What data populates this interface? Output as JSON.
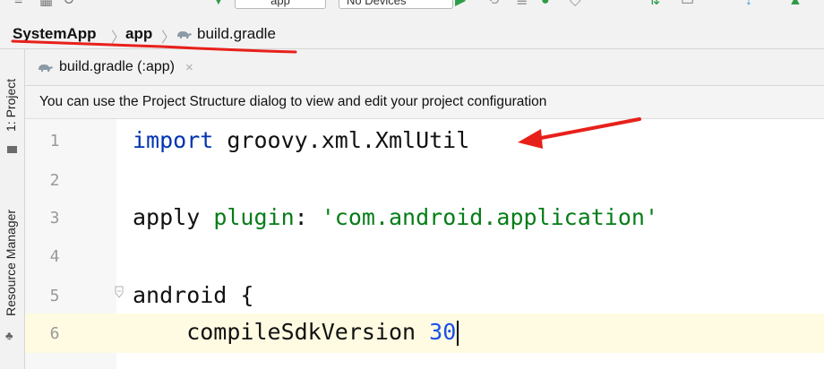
{
  "toolbar": {
    "run_config": "app",
    "device": "No Devices"
  },
  "breadcrumb": {
    "project": "SystemApp",
    "module": "app",
    "file": "build.gradle"
  },
  "sidebar": {
    "project_tab": "1: Project",
    "resource_tab": "Resource Manager"
  },
  "editor": {
    "tab_label": "build.gradle (:app)",
    "banner": "You can use the Project Structure dialog to view and edit your project configuration",
    "lines": [
      {
        "n": "1",
        "parts": [
          {
            "t": "import",
            "c": "kw"
          },
          {
            "t": " groovy.xml.XmlUtil",
            "c": ""
          }
        ]
      },
      {
        "n": "2",
        "parts": []
      },
      {
        "n": "3",
        "parts": [
          {
            "t": "apply ",
            "c": ""
          },
          {
            "t": "plugin",
            "c": "str"
          },
          {
            "t": ": ",
            "c": ""
          },
          {
            "t": "'com.android.application'",
            "c": "str"
          }
        ]
      },
      {
        "n": "4",
        "parts": []
      },
      {
        "n": "5",
        "parts": [
          {
            "t": "android {",
            "c": ""
          }
        ]
      },
      {
        "n": "6",
        "parts": [
          {
            "t": "    compileSdkVersion ",
            "c": ""
          },
          {
            "t": "30",
            "c": "num"
          }
        ]
      }
    ]
  },
  "colors": {
    "annotation_red": "#e8201a",
    "keyword_blue": "#0033b3",
    "string_green": "#067d17",
    "number_blue": "#1750eb"
  }
}
